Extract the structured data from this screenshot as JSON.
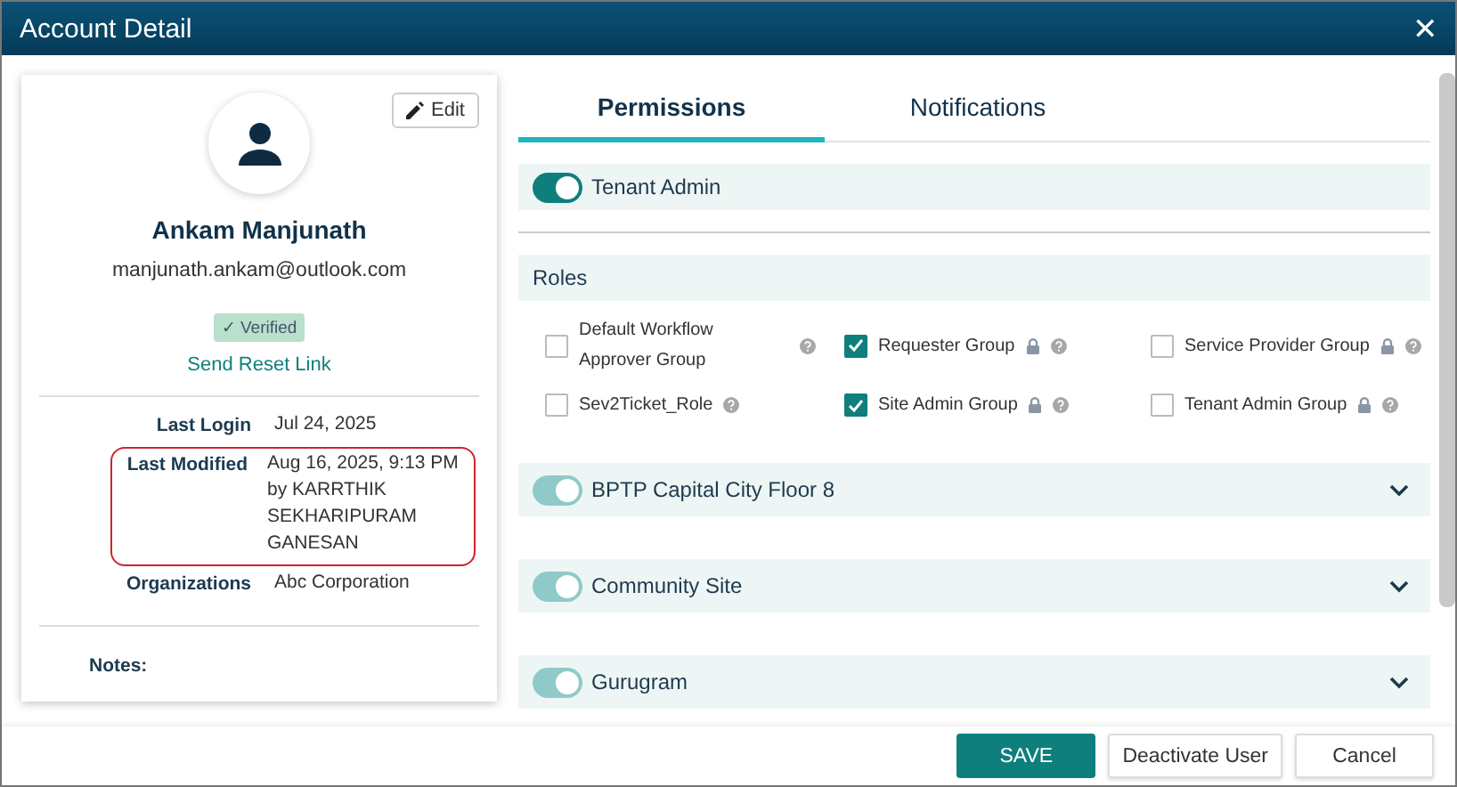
{
  "window": {
    "title": "Account Detail",
    "close": "✕"
  },
  "profile": {
    "edit": "Edit",
    "name": "Ankam Manjunath",
    "email": "manjunath.ankam@outlook.com",
    "badge": "✓ Verified",
    "reset_link": "Send Reset Link",
    "details": [
      {
        "label": "Last Login",
        "lines": [
          "Jul 24, 2025"
        ],
        "highlighted": false
      },
      {
        "label": "Last Modified",
        "lines": [
          "Aug 16, 2025, 9:13 PM",
          "by KARRTHIK",
          "SEKHARIPURAM",
          "GANESAN"
        ],
        "highlighted": true
      },
      {
        "label": "Organizations",
        "lines": [
          "Abc Corporation"
        ],
        "highlighted": false
      }
    ],
    "notes_label": "Notes:"
  },
  "tabs": [
    {
      "label": "Permissions",
      "selected": true
    },
    {
      "label": "Notifications",
      "selected": false
    }
  ],
  "tenant_admin": {
    "label": "Tenant Admin",
    "on": true,
    "disabled": false
  },
  "roles": {
    "title": "Roles",
    "items": [
      {
        "label": "Default Workflow Approver Group",
        "checked": false,
        "locked": false
      },
      {
        "label": "Requester Group",
        "checked": true,
        "locked": true
      },
      {
        "label": "Service Provider Group",
        "checked": false,
        "locked": true
      },
      {
        "label": "Sev2Ticket_Role",
        "checked": false,
        "locked": false
      },
      {
        "label": "Site Admin Group",
        "checked": true,
        "locked": true
      },
      {
        "label": "Tenant Admin Group",
        "checked": false,
        "locked": true
      }
    ]
  },
  "sites": [
    {
      "label": "BPTP Capital City Floor 8",
      "on": true,
      "disabled": true,
      "expanded": false
    },
    {
      "label": "Community Site",
      "on": true,
      "disabled": true,
      "expanded": false
    },
    {
      "label": "Gurugram",
      "on": true,
      "disabled": true,
      "expanded": false
    }
  ],
  "buttons": [
    {
      "label": "SAVE",
      "kind": "primary"
    },
    {
      "label": "Deactivate User",
      "kind": "secondary"
    },
    {
      "label": "Cancel",
      "kind": "secondary"
    }
  ]
}
